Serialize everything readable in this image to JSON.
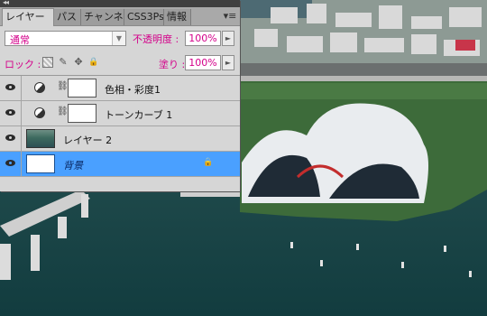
{
  "panel": {
    "collapse_glyph": "◂◂",
    "menu_glyph": "▾≡",
    "tabs": [
      {
        "label": "レイヤー",
        "active": true
      },
      {
        "label": "パス",
        "active": false
      },
      {
        "label": "チャンネ",
        "active": false
      },
      {
        "label": "CSS3Ps",
        "active": false
      },
      {
        "label": "情報",
        "active": false
      }
    ],
    "blend_mode": "通常",
    "blend_arrow": "▼",
    "opacity_label": "不透明度 :",
    "opacity_value": "100%",
    "stepper_arrow": "►",
    "lock_label": "ロック :",
    "lock_icons": [
      "transparent-pixels-icon",
      "brush-icon",
      "move-icon",
      "lock-icon"
    ],
    "lock_glyphs": {
      "brush": "✎",
      "move": "✥",
      "lock": "🔒"
    },
    "fill_label": "塗り :",
    "fill_value": "100%"
  },
  "layers": [
    {
      "name": "色相・彩度1",
      "type": "adjustment",
      "selected": false
    },
    {
      "name": "トーンカーブ 1",
      "type": "adjustment",
      "selected": false
    },
    {
      "name": "レイヤー 2",
      "type": "image",
      "selected": false
    },
    {
      "name": "背景",
      "type": "background",
      "selected": true,
      "locked": true
    }
  ],
  "glyphs": {
    "link": "⛓",
    "lock_badge": "🔒"
  }
}
